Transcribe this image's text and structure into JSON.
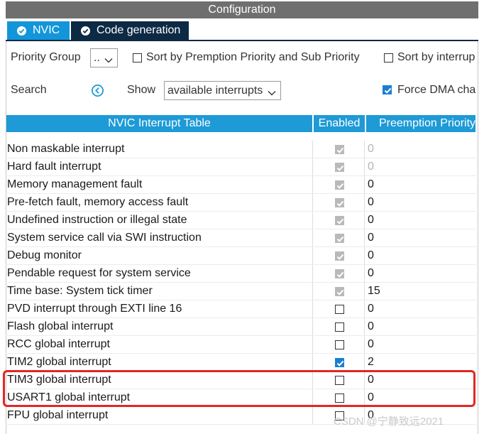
{
  "window": {
    "title": "Configuration"
  },
  "tabs": [
    {
      "label": "NVIC"
    },
    {
      "label": "Code generation"
    }
  ],
  "controls": {
    "priority_group_label": "Priority Group",
    "priority_group_value": "..",
    "sort_premption_label": "Sort by Premption Priority and Sub Priority",
    "sort_interrupt_label": "Sort by interrup",
    "search_label": "Search",
    "show_label": "Show",
    "show_value": "available interrupts",
    "force_dma_label": "Force DMA cha"
  },
  "table": {
    "headers": {
      "name": "NVIC Interrupt Table",
      "enabled": "Enabled",
      "preemption": "Preemption Priority"
    },
    "rows": [
      {
        "name": "Non maskable interrupt",
        "enabled": true,
        "locked": true,
        "priority": "0",
        "priority_disabled": true
      },
      {
        "name": "Hard fault interrupt",
        "enabled": true,
        "locked": true,
        "priority": "0",
        "priority_disabled": true
      },
      {
        "name": "Memory management fault",
        "enabled": true,
        "locked": true,
        "priority": "0",
        "priority_disabled": false
      },
      {
        "name": "Pre-fetch fault, memory access fault",
        "enabled": true,
        "locked": true,
        "priority": "0",
        "priority_disabled": false
      },
      {
        "name": "Undefined instruction or illegal state",
        "enabled": true,
        "locked": true,
        "priority": "0",
        "priority_disabled": false
      },
      {
        "name": "System service call via SWI instruction",
        "enabled": true,
        "locked": true,
        "priority": "0",
        "priority_disabled": false
      },
      {
        "name": "Debug monitor",
        "enabled": true,
        "locked": true,
        "priority": "0",
        "priority_disabled": false
      },
      {
        "name": "Pendable request for system service",
        "enabled": true,
        "locked": true,
        "priority": "0",
        "priority_disabled": false
      },
      {
        "name": "Time base: System tick timer",
        "enabled": true,
        "locked": true,
        "priority": "15",
        "priority_disabled": false
      },
      {
        "name": "PVD interrupt through EXTI line 16",
        "enabled": false,
        "locked": false,
        "priority": "0",
        "priority_disabled": false
      },
      {
        "name": "Flash global interrupt",
        "enabled": false,
        "locked": false,
        "priority": "0",
        "priority_disabled": false
      },
      {
        "name": "RCC global interrupt",
        "enabled": false,
        "locked": false,
        "priority": "0",
        "priority_disabled": false
      },
      {
        "name": "TIM2 global interrupt",
        "enabled": true,
        "locked": false,
        "priority": "2",
        "priority_disabled": false
      },
      {
        "name": "TIM3 global interrupt",
        "enabled": false,
        "locked": false,
        "priority": "0",
        "priority_disabled": false
      },
      {
        "name": "USART1 global interrupt",
        "enabled": false,
        "locked": false,
        "priority": "0",
        "priority_disabled": false
      },
      {
        "name": "FPU global interrupt",
        "enabled": false,
        "locked": false,
        "priority": "0",
        "priority_disabled": false
      }
    ]
  },
  "watermark": "CSDN @宁静致远2021",
  "colors": {
    "tab_active": "#1296d9",
    "tab_inactive": "#0d2a45",
    "header_blue": "#1e9ad6",
    "title_bar": "#6f6f6f",
    "highlight_red": "#e32626",
    "checkbox_blue": "#1a7fd4"
  }
}
